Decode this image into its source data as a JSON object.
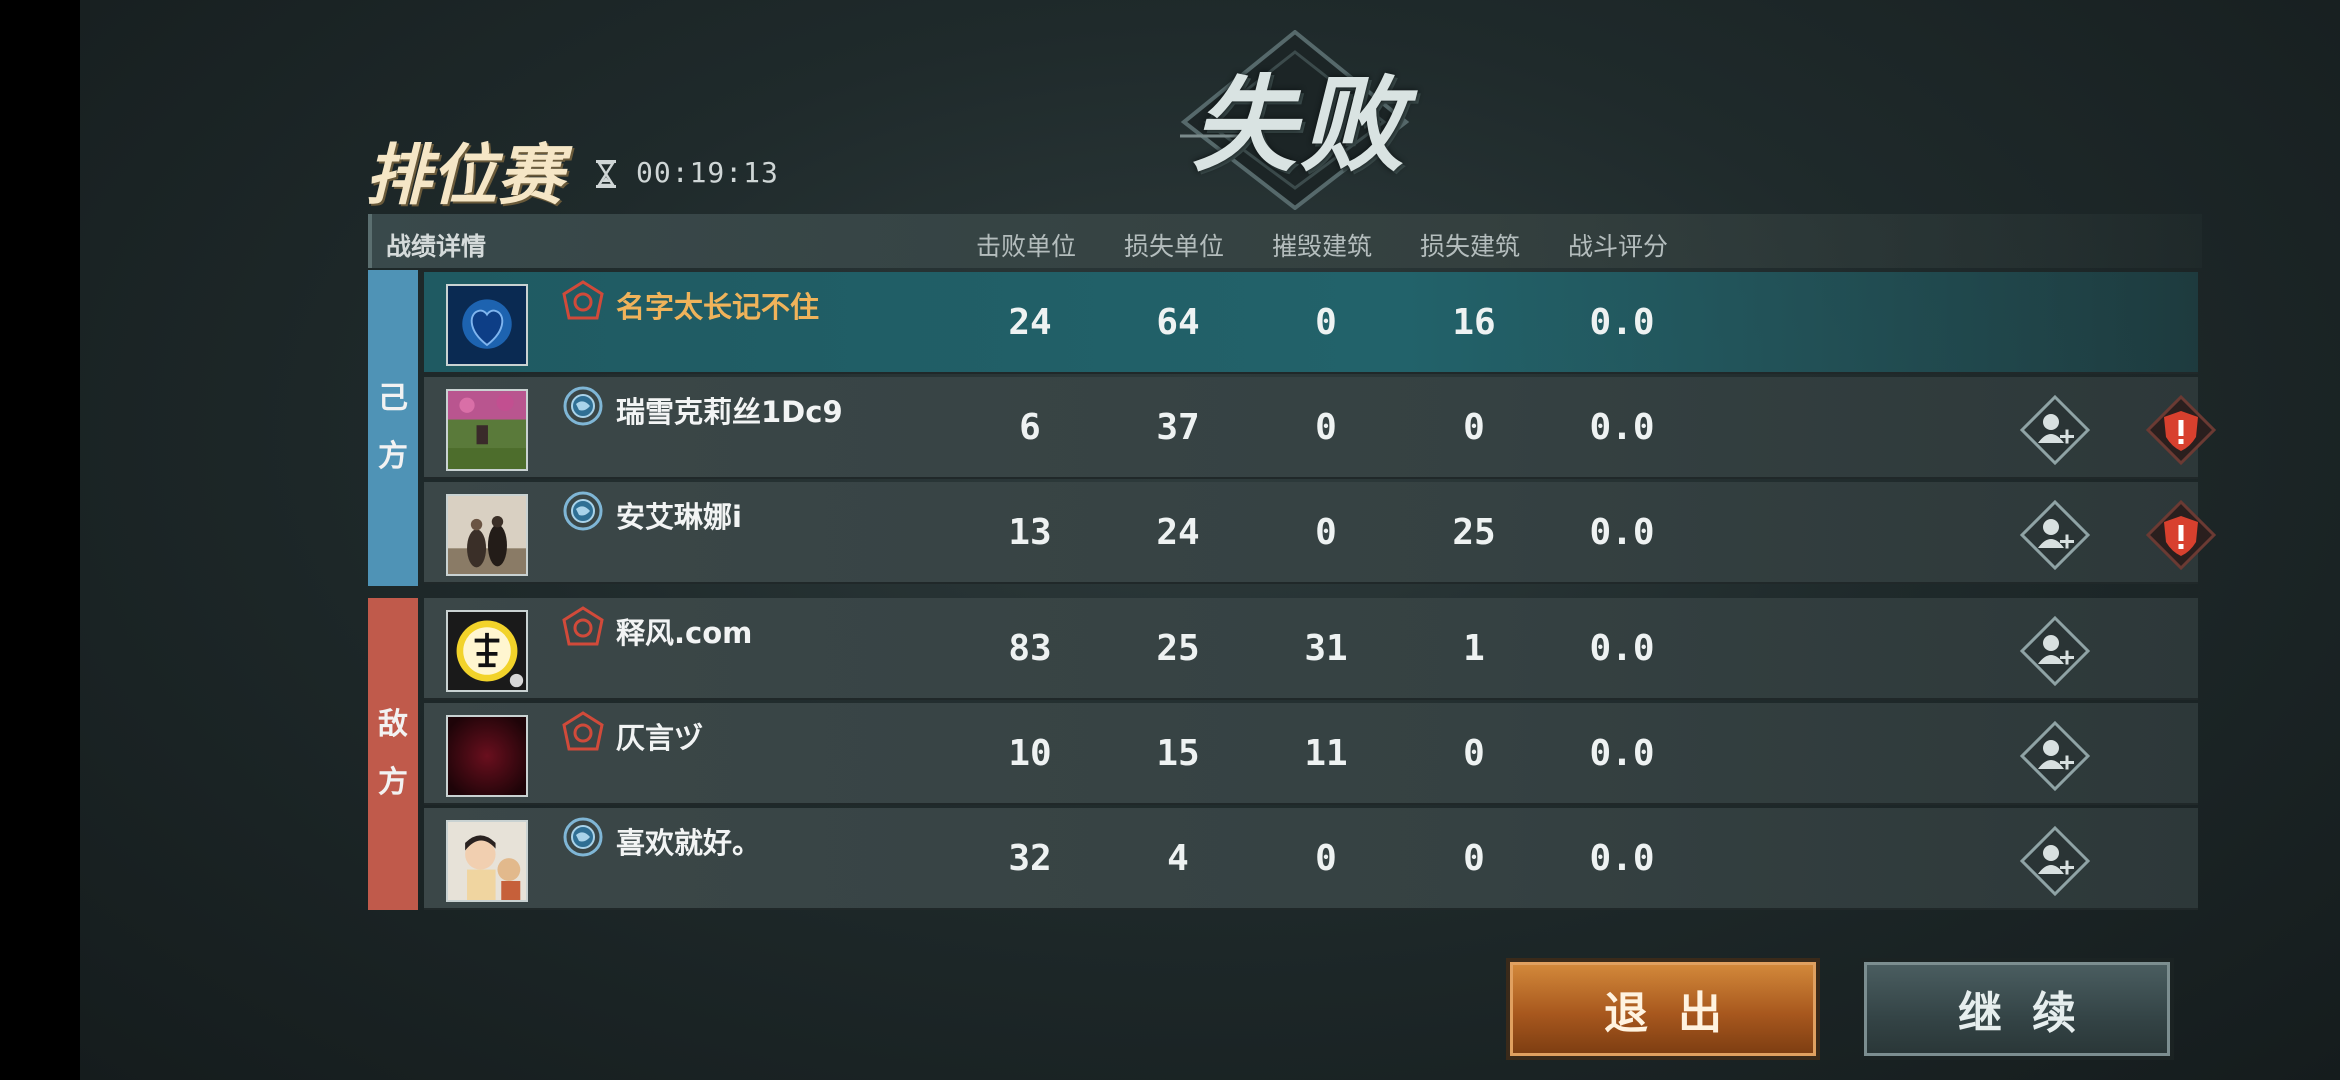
{
  "result_title": "失败",
  "mode_title": "排位赛",
  "timer": "00:19:13",
  "table": {
    "title": "战绩详情",
    "columns": [
      "击败单位",
      "损失单位",
      "摧毁建筑",
      "损失建筑",
      "战斗评分"
    ]
  },
  "sides": {
    "ally": "己方",
    "enemy": "敌方"
  },
  "players": [
    {
      "name": "名字太长记不住",
      "rank_icon": "red-rank-icon",
      "stats": [
        "24",
        "64",
        "0",
        "16",
        "0.0"
      ],
      "avatar": "blue-heart-avatar"
    },
    {
      "name": "瑞雪克莉丝1Dc9",
      "rank_icon": "blue-globe-rank-icon",
      "stats": [
        "6",
        "37",
        "0",
        "0",
        "0.0"
      ],
      "avatar": "garden-photo-avatar"
    },
    {
      "name": "安艾琳娜i",
      "rank_icon": "blue-globe-rank-icon",
      "stats": [
        "13",
        "24",
        "0",
        "25",
        "0.0"
      ],
      "avatar": "couple-photo-avatar"
    },
    {
      "name": "释风.com",
      "rank_icon": "red-rank-icon",
      "stats": [
        "83",
        "25",
        "31",
        "1",
        "0.0"
      ],
      "avatar": "calligraphy-avatar"
    },
    {
      "name": "仄言ヅ",
      "rank_icon": "red-rank-icon",
      "stats": [
        "10",
        "15",
        "11",
        "0",
        "0.0"
      ],
      "avatar": "dark-red-avatar"
    },
    {
      "name": "喜欢就好。",
      "rank_icon": "blue-globe-rank-icon",
      "stats": [
        "32",
        "4",
        "0",
        "0",
        "0.0"
      ],
      "avatar": "child-photo-avatar"
    }
  ],
  "buttons": {
    "exit": "退出",
    "continue": "继续"
  },
  "colors": {
    "ally": "#4f93b6",
    "enemy": "#c05a4b",
    "self_highlight": "#22626a",
    "self_name": "#f0b35a",
    "report": "#d8402e"
  }
}
